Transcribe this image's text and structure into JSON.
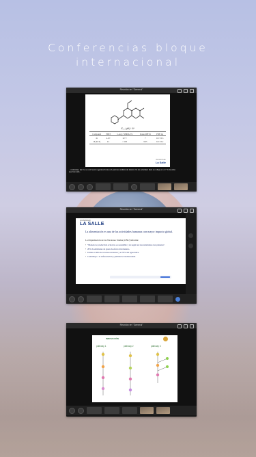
{
  "page": {
    "title_line1": "Conferencias bloque",
    "title_line2": "internacional"
  },
  "screens": [
    {
      "meeting_title": "Reunión en \"General\"",
      "slide": {
        "caption": "IC₅₀ (µM) / Ki*",
        "table": {
          "headers": [
            "Compound",
            "PDE5",
            "L-Arg / NMDA 5%",
            "Kaseo DHT4",
            "PDE 3/µ"
          ],
          "rows": [
            [
              "1b",
              "4.6 ±",
              "6.7 ±",
              "7",
              "0.5 ± 0.3"
            ],
            [
              "16 (4CT)",
              "2.1",
              "> 100",
              "9.65",
              "0.3 ± 0.2"
            ]
          ]
        },
        "logo": "La Salle",
        "logo_sub": "UNIVERSIDAD"
      },
      "subtitle": "...moléculas, las 8 a su vez fueron agentes frente a 6 patrones sólidos de interés: fin de actividad. Esto se refleja en el 7 % de ellos que han sido..."
    },
    {
      "meeting_title": "Reunión en \"General\"",
      "slide": {
        "logo": "LA SALLE",
        "logo_sub": "UNIVERSIDAD",
        "heading": "La alimentación es una de las actividades humanas con mayor impacto global.",
        "intro": "La Organización de las Naciones Unidas (ONU) informa:",
        "bullets": [
          "\"Modelo de producción actual no es sostenible y de seguir así necesitaríamos tres planetas\".",
          "26% de emisiones de gases de efecto invernadero.",
          "Utiliza el 40% de recursos terrestres y el 70% del agua dulce.",
          "Contribuye a la deforestación y pérdida de biodiversidad."
        ]
      }
    },
    {
      "meeting_title": "Reunión en \"General\"",
      "slide": {
        "org_label": "INNOVACIÓN",
        "columns": [
          "pathway 1",
          "pathway 2",
          "pathway 3"
        ]
      }
    }
  ],
  "colors": {
    "title_text": "#ffffff",
    "slide_logo_blue": "#16367d",
    "teams_blue": "#4b7fd6"
  }
}
